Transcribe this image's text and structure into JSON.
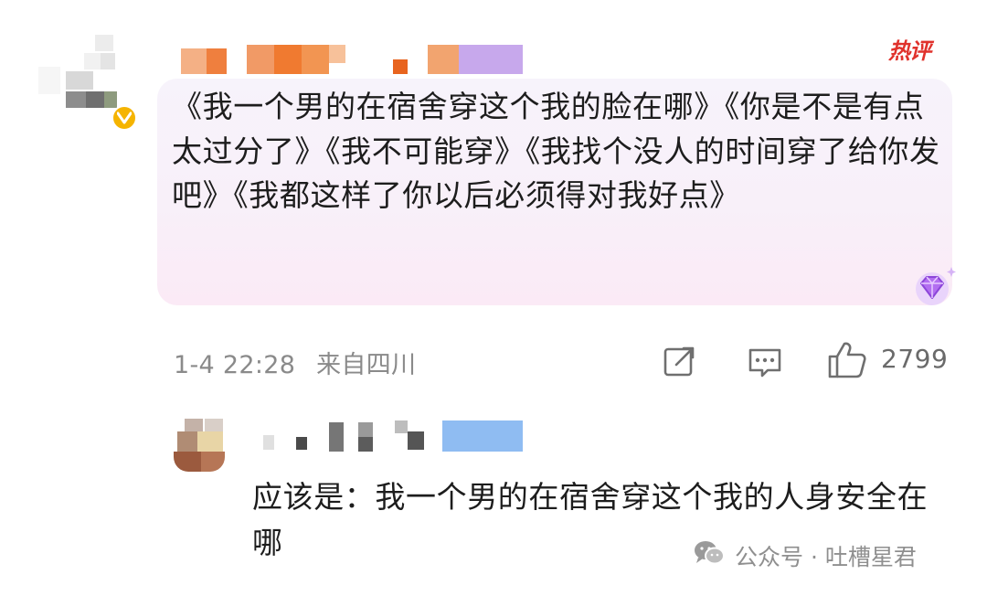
{
  "comment": {
    "hot_label": "热评",
    "text": "《我一个男的在宿舍穿这个我的脸在哪》《你是不是有点太过分了》《我不可能穿》《我找个没人的时间穿了给你发吧》《我都这样了你以后必须得对我好点》",
    "timestamp": "1-4 22:28",
    "location": "来自四川",
    "like_count": "2799"
  },
  "reply": {
    "text": "应该是：我一个男的在宿舍穿这个我的人身安全在哪"
  },
  "watermark": {
    "text": "公众号 · 吐槽星君"
  },
  "icons": [
    "verified-badge-icon",
    "share-edit-icon",
    "comment-icon",
    "thumbs-up-icon",
    "diamond-badge-icon",
    "wechat-icon"
  ],
  "colors": {
    "hot_badge": "#e0322c",
    "verified": "#f5b400",
    "bubble_bg": "#f7f3fb",
    "meta_text": "#8a8a8a"
  }
}
